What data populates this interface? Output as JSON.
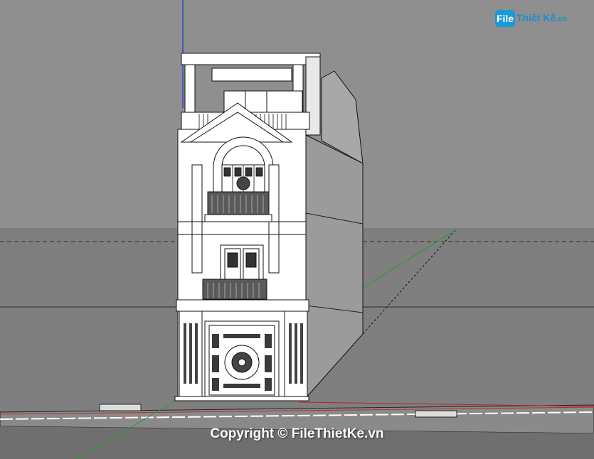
{
  "viewport": {
    "sky_color": "#8f8f8f",
    "ground_color": "#7d7d7d",
    "road_color": "#6a6a6a",
    "model_line_color": "#000000",
    "model_face_color": "#ffffff",
    "side_face_color": "#9a9a9a",
    "axis_blue": "#2030d0",
    "axis_green": "#20a030",
    "axis_red": "#c02020"
  },
  "watermark": {
    "logo_badge": "File",
    "logo_name": "Thiết Kế",
    "logo_domain": ".vn",
    "copyright": "Copyright © FileThietKe.vn"
  }
}
